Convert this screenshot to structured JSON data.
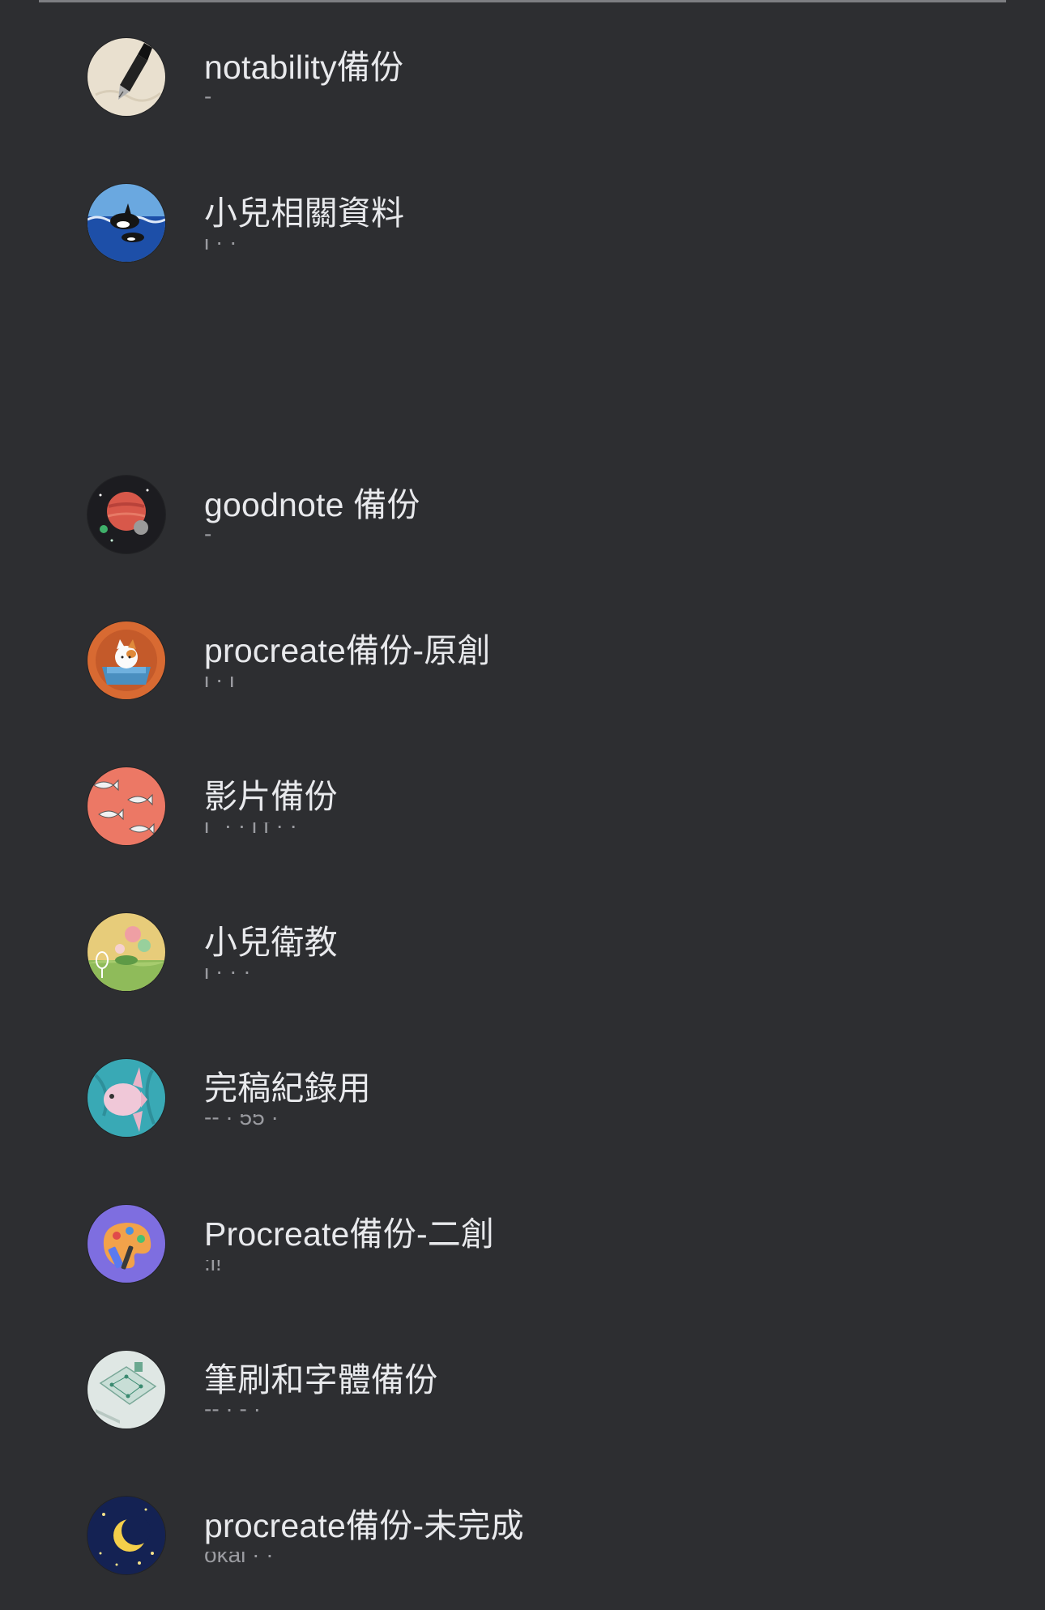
{
  "accounts": [
    {
      "name": "notability備份",
      "avatar_icon": "fountain-pen-icon"
    },
    {
      "name": "小兒相關資料",
      "avatar_icon": "orca-whale-icon"
    },
    {
      "name": "goodnote 備份",
      "avatar_icon": "planet-space-icon"
    },
    {
      "name": "procreate備份-原創",
      "avatar_icon": "cat-in-box-icon"
    },
    {
      "name": "影片備份",
      "avatar_icon": "fish-pattern-icon"
    },
    {
      "name": "小兒衛教",
      "avatar_icon": "bubbles-landscape-icon"
    },
    {
      "name": "完稿紀錄用",
      "avatar_icon": "sunfish-icon"
    },
    {
      "name": "Procreate備份-二創",
      "avatar_icon": "paint-palette-icon"
    },
    {
      "name": "筆刷和字體備份",
      "avatar_icon": "drafting-desk-icon"
    },
    {
      "name": "procreate備份-未完成",
      "avatar_icon": "crescent-moon-icon"
    }
  ],
  "colors": {
    "background": "#2d2e31",
    "divider": "#7d7e82",
    "name_text": "#e8e9ec",
    "sub_text": "#9a9ba0"
  }
}
